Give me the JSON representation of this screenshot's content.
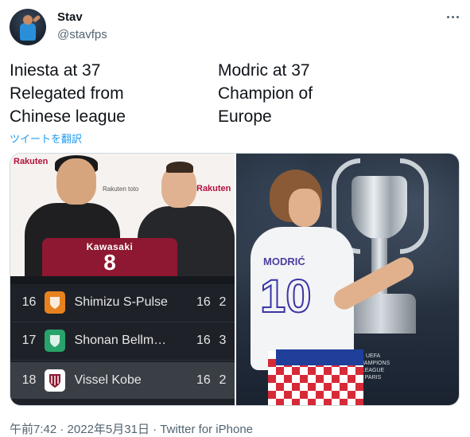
{
  "user": {
    "name": "Stav",
    "handle": "@stavfps"
  },
  "tweet": {
    "left_text": "Iniesta at 37\nRelegated from\nChinese league",
    "right_text": "Modric at 37\nChampion of\nEurope",
    "translate_label": "ツイートを翻訳"
  },
  "media": {
    "left_photo": {
      "backdrop_words": [
        "Rakuten",
        "Rakuten toto",
        "Rakuten"
      ],
      "shirt_sponsor": "Kawasaki",
      "shirt_number": "8"
    },
    "standings": [
      {
        "pos": "16",
        "team": "Shimizu S-Pulse",
        "played": "16",
        "pts": "2",
        "crest_color": "#e8821e"
      },
      {
        "pos": "17",
        "team": "Shonan Bellm…",
        "played": "16",
        "pts": "3",
        "crest_color": "#27a36b"
      },
      {
        "pos": "18",
        "team": "Vissel Kobe",
        "played": "16",
        "pts": "2",
        "crest_color": "#8e1831"
      }
    ],
    "right_photo": {
      "shirt_name": "MODRIĆ",
      "shirt_number": "10",
      "trophy_text": "UEFA CHAMPIONS LEAGUE PARIS"
    }
  },
  "meta": {
    "time": "午前7:42",
    "sep1": " · ",
    "date": "2022年5月31日",
    "sep2": " · ",
    "source": "Twitter for iPhone"
  },
  "colors": {
    "accent": "#1d9bf0",
    "text": "#0f1419",
    "muted": "#536471"
  }
}
